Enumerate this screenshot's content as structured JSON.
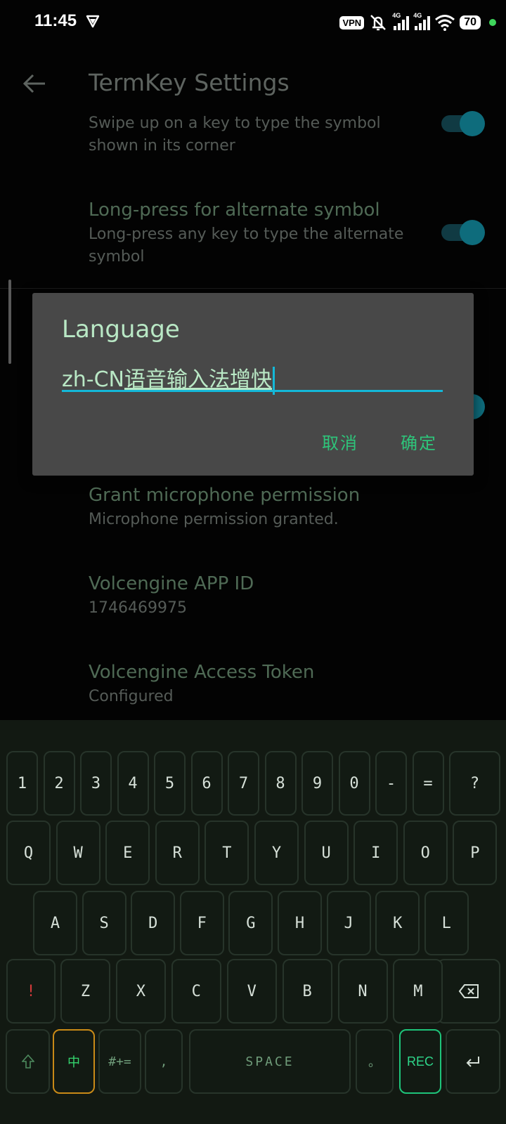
{
  "status_bar": {
    "time": "11:45",
    "vpn_label": "VPN",
    "signal1_label": "4G",
    "signal2_label": "4G",
    "battery": "70",
    "icons": [
      "vpn-app-icon",
      "mute-icon",
      "signal-icon",
      "wifi-icon",
      "battery-icon"
    ]
  },
  "app_bar": {
    "title": "TermKey Settings",
    "back_icon": "arrow-left-icon"
  },
  "settings": {
    "swipe_up": {
      "subtitle": "Swipe up on a key to type the symbol shown in its corner",
      "enabled": true
    },
    "long_press": {
      "title": "Long-press for alternate symbol",
      "subtitle": "Long-press any key to type the alternate symbol",
      "enabled": true
    },
    "microphone": {
      "title": "Grant microphone permission",
      "subtitle": "Microphone permission granted."
    },
    "app_id": {
      "title": "Volcengine APP ID",
      "subtitle": "1746469975"
    },
    "access_token": {
      "title": "Volcengine Access Token",
      "subtitle": "Configured"
    }
  },
  "dialog": {
    "title": "Language",
    "input_committed": "zh-CN",
    "input_composing": "语音输入法增快",
    "cancel_label": "取消",
    "ok_label": "确定"
  },
  "keyboard": {
    "row_numbers": [
      "1",
      "2",
      "3",
      "4",
      "5",
      "6",
      "7",
      "8",
      "9",
      "0",
      "-",
      "=",
      "?"
    ],
    "row_qwerty": [
      "Q",
      "W",
      "E",
      "R",
      "T",
      "Y",
      "U",
      "I",
      "O",
      "P"
    ],
    "row_home": [
      "A",
      "S",
      "D",
      "F",
      "G",
      "H",
      "J",
      "K",
      "L"
    ],
    "row_bottom": [
      "!",
      "Z",
      "X",
      "C",
      "V",
      "B",
      "N",
      "M"
    ],
    "backspace_icon": "backspace-icon",
    "shift_icon": "shift-icon",
    "enter_icon": "enter-icon",
    "lang_key": "中",
    "symbols_key": "#+=",
    "comma_key": ",",
    "space_key": "SPACE",
    "period_key": "。",
    "rec_key": "REC",
    "colors": {
      "accent": "#2ec47a",
      "zh_border": "#c98a17",
      "rec_border": "#1ec47a",
      "danger": "#d23a3a"
    }
  }
}
